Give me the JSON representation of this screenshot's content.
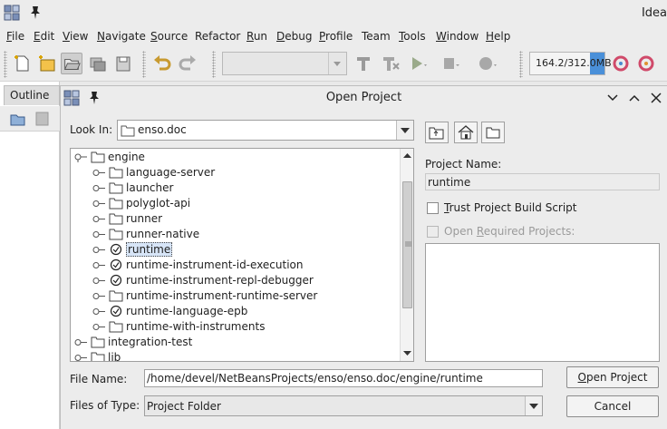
{
  "ide": {
    "title": "Idea",
    "menus": [
      {
        "label": "File",
        "mnemonic": "F",
        "rest": "ile"
      },
      {
        "label": "Edit",
        "mnemonic": "E",
        "rest": "dit"
      },
      {
        "label": "View",
        "mnemonic": "V",
        "rest": "iew"
      },
      {
        "label": "Navigate",
        "mnemonic": "N",
        "rest": "avigate"
      },
      {
        "label": "Source",
        "mnemonic": "S",
        "rest": "ource"
      },
      {
        "label": "Refactor",
        "mnemonic": "",
        "rest": "Refactor"
      },
      {
        "label": "Run",
        "mnemonic": "R",
        "rest": "un"
      },
      {
        "label": "Debug",
        "mnemonic": "D",
        "rest": "ebug"
      },
      {
        "label": "Profile",
        "mnemonic": "P",
        "rest": "rofile"
      },
      {
        "label": "Team",
        "mnemonic": "",
        "rest": "Team"
      },
      {
        "label": "Tools",
        "mnemonic": "T",
        "rest": "ools"
      },
      {
        "label": "Window",
        "mnemonic": "W",
        "rest": "indow"
      },
      {
        "label": "Help",
        "mnemonic": "H",
        "rest": "elp"
      }
    ],
    "memory": "164.2/312.0MB",
    "memory_used_fraction": 0.53,
    "outline_tab": "Outline"
  },
  "dialog": {
    "title": "Open Project",
    "look_in_label": "Look In:",
    "look_in_value": "enso.doc",
    "tree": [
      {
        "label": "engine",
        "level": 0,
        "kind": "folder",
        "expanded": true
      },
      {
        "label": "language-server",
        "level": 1,
        "kind": "folder"
      },
      {
        "label": "launcher",
        "level": 1,
        "kind": "folder"
      },
      {
        "label": "polyglot-api",
        "level": 1,
        "kind": "folder"
      },
      {
        "label": "runner",
        "level": 1,
        "kind": "folder"
      },
      {
        "label": "runner-native",
        "level": 1,
        "kind": "folder"
      },
      {
        "label": "runtime",
        "level": 1,
        "kind": "project",
        "selected": true
      },
      {
        "label": "runtime-instrument-id-execution",
        "level": 1,
        "kind": "project"
      },
      {
        "label": "runtime-instrument-repl-debugger",
        "level": 1,
        "kind": "project"
      },
      {
        "label": "runtime-instrument-runtime-server",
        "level": 1,
        "kind": "folder"
      },
      {
        "label": "runtime-language-epb",
        "level": 1,
        "kind": "project"
      },
      {
        "label": "runtime-with-instruments",
        "level": 1,
        "kind": "folder"
      },
      {
        "label": "integration-test",
        "level": 0,
        "kind": "folder"
      },
      {
        "label": "lib",
        "level": 0,
        "kind": "folder"
      }
    ],
    "project_name_label": "Project Name:",
    "project_name_value": "runtime",
    "trust_label_mnemonic": "T",
    "trust_label_rest": "rust Project Build Script",
    "open_required_label_pre": "Open ",
    "open_required_label_mnemonic": "R",
    "open_required_label_rest": "equired Projects:",
    "file_name_label": "File Name:",
    "file_name_value": "/home/devel/NetBeansProjects/enso/enso.doc/engine/runtime",
    "files_of_type_label": "Files of Type:",
    "files_of_type_value": "Project Folder",
    "open_project_mnemonic": "O",
    "open_project_rest": "pen Project",
    "cancel_label": "Cancel"
  }
}
